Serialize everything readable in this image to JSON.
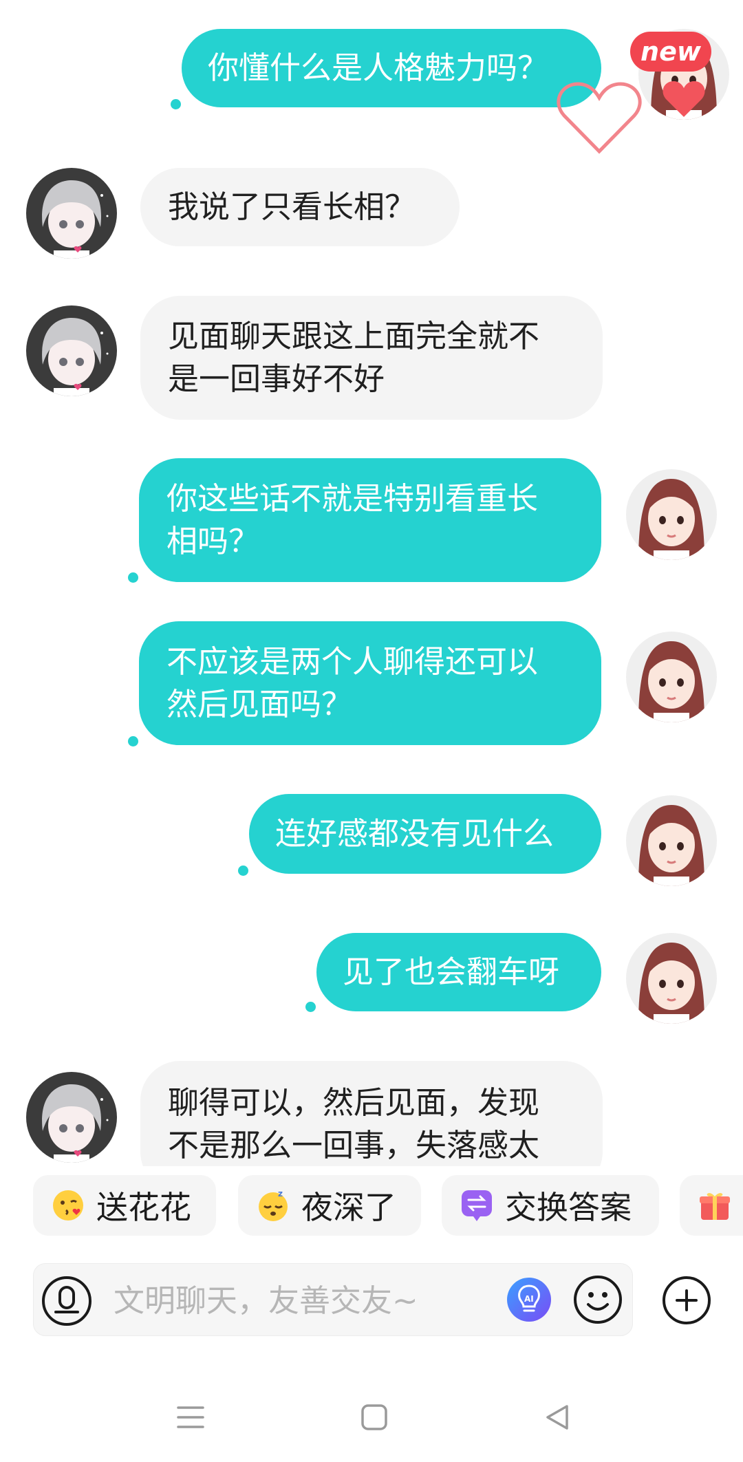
{
  "messages": [
    {
      "id": "m1",
      "side": "me",
      "text": "你懂什么是人格魅力吗？"
    },
    {
      "id": "m2",
      "side": "them",
      "text": "我说了只看长相？"
    },
    {
      "id": "m3",
      "side": "them",
      "line1": "见面聊天跟这上面完全就不",
      "line2": "是一回事好不好"
    },
    {
      "id": "m4",
      "side": "me",
      "line1": "你这些话不就是特别看重长",
      "line2": "相吗？"
    },
    {
      "id": "m5",
      "side": "me",
      "line1": "不应该是两个人聊得还可以",
      "line2": "然后见面吗？"
    },
    {
      "id": "m6",
      "side": "me",
      "text": "连好感都没有见什么"
    },
    {
      "id": "m7",
      "side": "me",
      "text": "见了也会翻车呀"
    },
    {
      "id": "m8",
      "side": "them",
      "line1": "聊得可以，然后见面，发现",
      "line2": "不是那么一回事，失落感太"
    }
  ],
  "badge": {
    "label": "new"
  },
  "chips": [
    {
      "label": "送花花",
      "icon": "kiss-face-icon"
    },
    {
      "label": "夜深了",
      "icon": "sleepy-face-icon"
    },
    {
      "label": "交换答案",
      "icon": "exchange-icon"
    },
    {
      "label": "",
      "icon": "gift-icon"
    }
  ],
  "input": {
    "placeholder": "文明聊天，友善交友~",
    "value": ""
  },
  "colors": {
    "accent": "#25d2d0",
    "badge": "#f1454f",
    "bubble_other": "#f4f4f4"
  }
}
